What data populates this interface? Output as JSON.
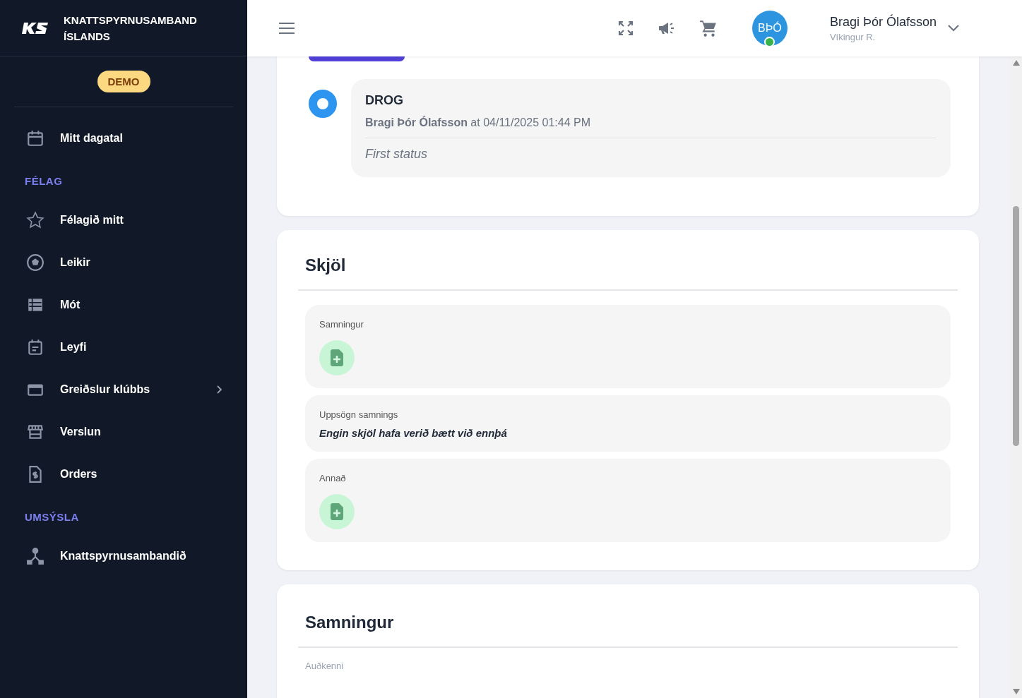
{
  "brand": {
    "name": "KNATTSPYRNUSAMBAND ÍSLANDS",
    "badge": "DEMO"
  },
  "sidebar": {
    "items": [
      {
        "kind": "link",
        "label": "Mitt dagatal",
        "expandable": false
      },
      {
        "kind": "section",
        "label": "FÉLAG"
      },
      {
        "kind": "link",
        "label": "Félagið mitt",
        "expandable": false
      },
      {
        "kind": "link",
        "label": "Leikir",
        "expandable": false
      },
      {
        "kind": "link",
        "label": "Mót",
        "expandable": false
      },
      {
        "kind": "link",
        "label": "Leyfi",
        "expandable": false
      },
      {
        "kind": "link",
        "label": "Greiðslur klúbbs",
        "expandable": true
      },
      {
        "kind": "link",
        "label": "Verslun",
        "expandable": false
      },
      {
        "kind": "link",
        "label": "Orders",
        "expandable": false
      },
      {
        "kind": "section",
        "label": "UMSÝSLA"
      },
      {
        "kind": "link",
        "label": "Knattspyrnusambandið",
        "expandable": false
      }
    ]
  },
  "header": {
    "user": {
      "name": "Bragi Þór Ólafsson",
      "club": "Víkingur R.",
      "initials": "BÞÓ",
      "online": true
    }
  },
  "timeline": [
    {
      "status": "DROG",
      "byline": "**Bragi Þór Ólafsson** at 04/11/2025 01:44 PM",
      "note": "First status"
    }
  ],
  "documents": {
    "title": "Skjöl",
    "groups": [
      {
        "label": "Samningur",
        "kind": "upload"
      },
      {
        "label": "Uppsögn samnings",
        "kind": "empty",
        "message": "Engin skjöl hafa verið bætt við ennþá"
      },
      {
        "label": "Annað",
        "kind": "upload"
      }
    ]
  },
  "contract": {
    "title": "Samningur",
    "fields": [
      {
        "label": "Auðkenni"
      }
    ]
  }
}
